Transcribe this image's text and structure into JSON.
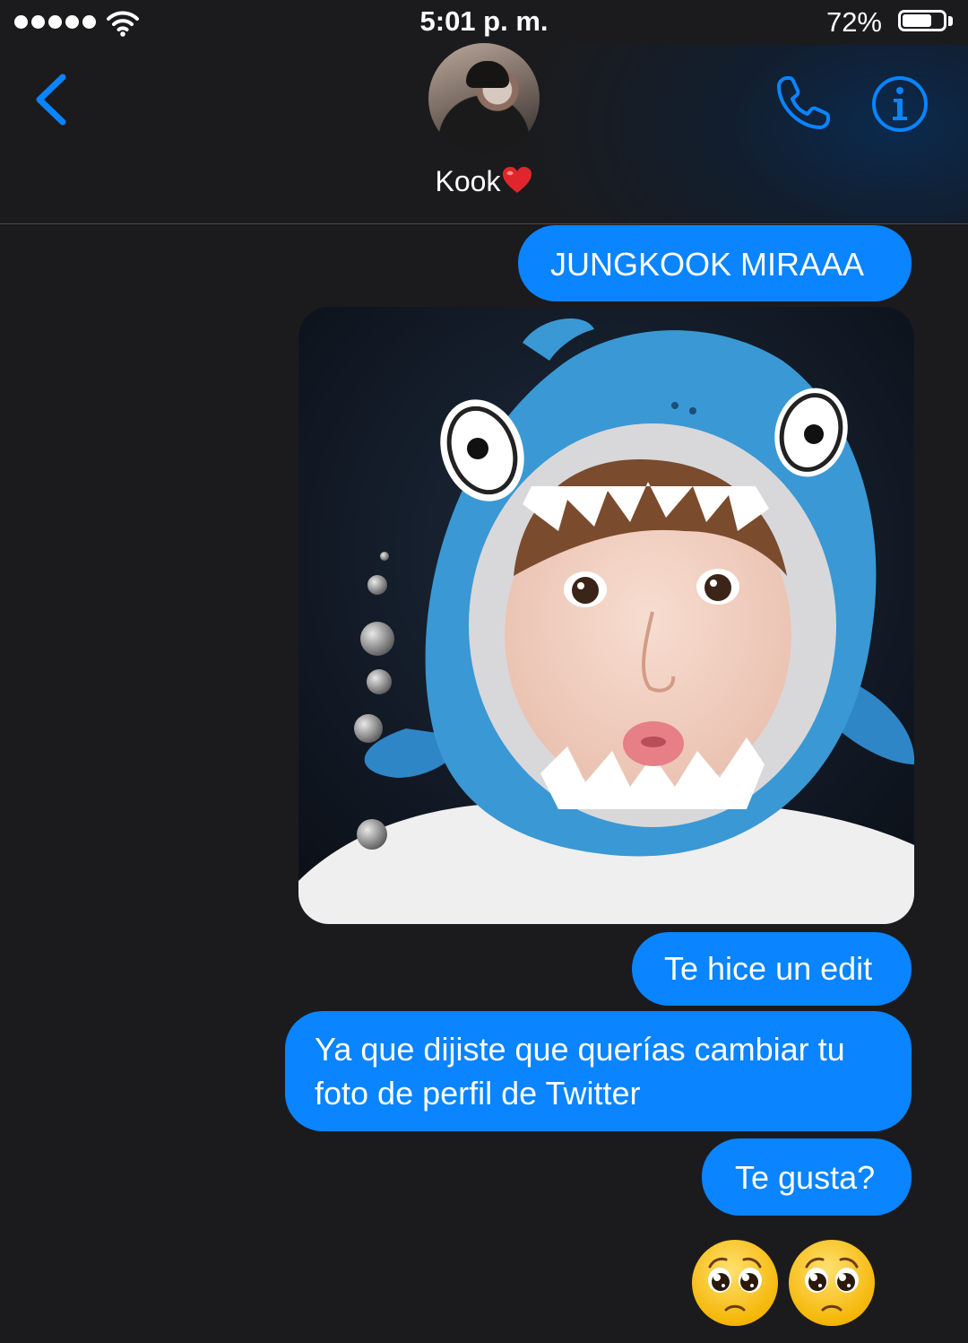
{
  "status_bar": {
    "time": "5:01 p. m.",
    "battery_percent": "72%",
    "battery_level": 0.72,
    "signal_bars": 5,
    "icons": [
      "signal-dots-icon",
      "wifi-icon",
      "battery-icon"
    ]
  },
  "header": {
    "contact_name": "Kook",
    "contact_name_suffix_icon": "red-heart-emoji",
    "back_icon": "chevron-left-icon",
    "call_icon": "phone-icon",
    "info_icon": "info-circle-icon",
    "accent_color": "#0a84ff"
  },
  "messages": [
    {
      "type": "text",
      "text": "JUNGKOOK MIRAAA"
    },
    {
      "type": "image",
      "description_icon": "photo-attachment"
    },
    {
      "type": "text",
      "text": "Te hice un edit"
    },
    {
      "type": "text",
      "text": "Ya que dijiste que querías cambiar tu foto de perfil de Twitter"
    },
    {
      "type": "text",
      "text": "Te gusta?"
    },
    {
      "type": "emoji",
      "icons": [
        "pleading-face-emoji",
        "pleading-face-emoji"
      ]
    }
  ],
  "colors": {
    "background": "#1b1b1d",
    "sent_bubble": "#0a84ff",
    "divider": "#4a4a4e"
  }
}
